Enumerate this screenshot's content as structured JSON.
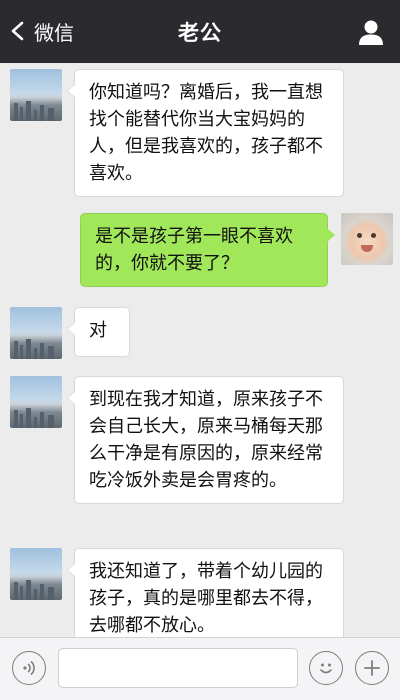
{
  "header": {
    "back_label": "微信",
    "title": "老公"
  },
  "messages": [
    {
      "side": "left",
      "avatar": "city-skyline-avatar",
      "text": "你知道吗？离婚后，我一直想找个能替代你当大宝妈妈的人，但是我喜欢的，孩子都不喜欢。"
    },
    {
      "side": "right",
      "avatar": "baby-photo-avatar",
      "text": "是不是孩子第一眼不喜欢的，你就不要了？"
    },
    {
      "side": "left",
      "avatar": "city-skyline-avatar",
      "text": "对"
    },
    {
      "side": "left",
      "avatar": "city-skyline-avatar",
      "text": "到现在我才知道，原来孩子不会自己长大，原来马桶每天那么干净是有原因的，原来经常吃冷饭外卖是会胃疼的。"
    },
    {
      "side": "left",
      "avatar": "city-skyline-avatar",
      "text": "我还知道了，带着个幼儿园的孩子，真的是哪里都去不得，去哪都不放心。"
    }
  ],
  "input_bar": {
    "voice_icon": "voice-icon",
    "emoji_icon": "emoji-icon",
    "plus_icon": "plus-icon",
    "input_value": ""
  },
  "colors": {
    "header_bg": "#2b2b2f",
    "chat_bg": "#ececec",
    "sent_bubble": "#a0e75a",
    "received_bubble": "#ffffff"
  }
}
